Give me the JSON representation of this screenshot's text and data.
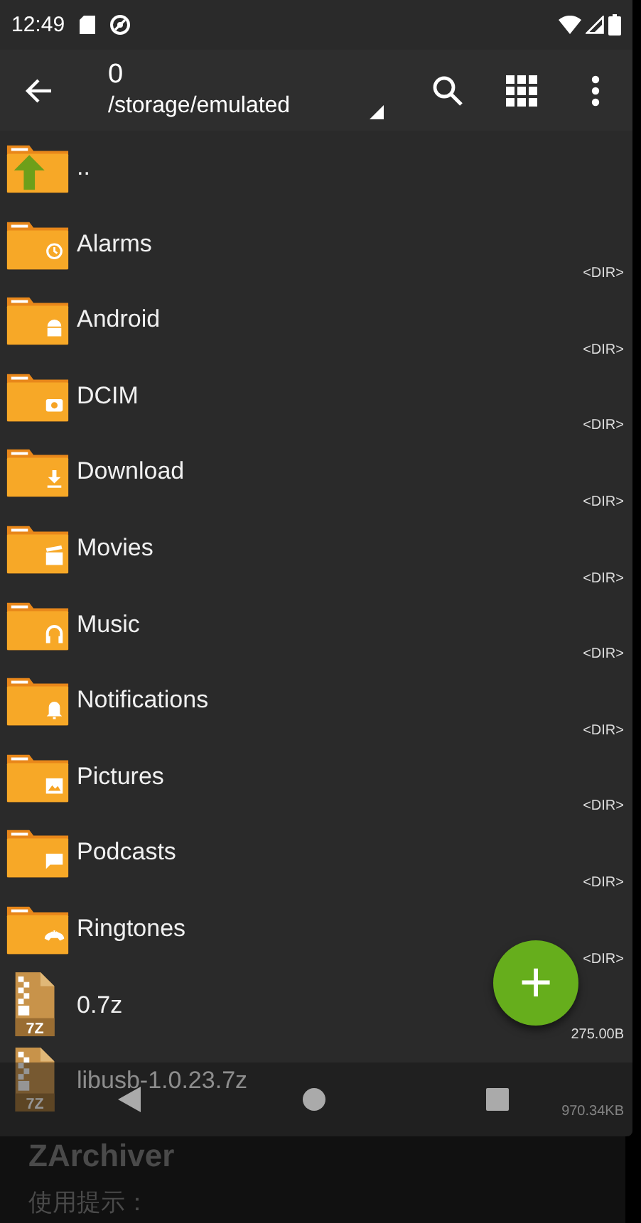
{
  "status_bar": {
    "time": "12:49"
  },
  "toolbar": {
    "title": "0",
    "path": "/storage/emulated"
  },
  "files": [
    {
      "name": "..",
      "kind": "up"
    },
    {
      "name": "Alarms",
      "kind": "folder",
      "size": "<DIR>"
    },
    {
      "name": "Android",
      "kind": "folder",
      "size": "<DIR>"
    },
    {
      "name": "DCIM",
      "kind": "folder",
      "size": "<DIR>"
    },
    {
      "name": "Download",
      "kind": "folder",
      "size": "<DIR>"
    },
    {
      "name": "Movies",
      "kind": "folder",
      "size": "<DIR>"
    },
    {
      "name": "Music",
      "kind": "folder",
      "size": "<DIR>"
    },
    {
      "name": "Notifications",
      "kind": "folder",
      "size": "<DIR>"
    },
    {
      "name": "Pictures",
      "kind": "folder",
      "size": "<DIR>"
    },
    {
      "name": "Podcasts",
      "kind": "folder",
      "size": "<DIR>"
    },
    {
      "name": "Ringtones",
      "kind": "folder",
      "size": "<DIR>"
    },
    {
      "name": "0.7z",
      "kind": "archive",
      "badge": "7Z",
      "size": "275.00B"
    },
    {
      "name": "libusb-1.0.23.7z",
      "kind": "archive",
      "badge": "7Z",
      "size": "970.34KB"
    }
  ],
  "fab": {
    "label": "+"
  },
  "dialog": {
    "title": "ZArchiver",
    "heading": "使用提示："
  }
}
